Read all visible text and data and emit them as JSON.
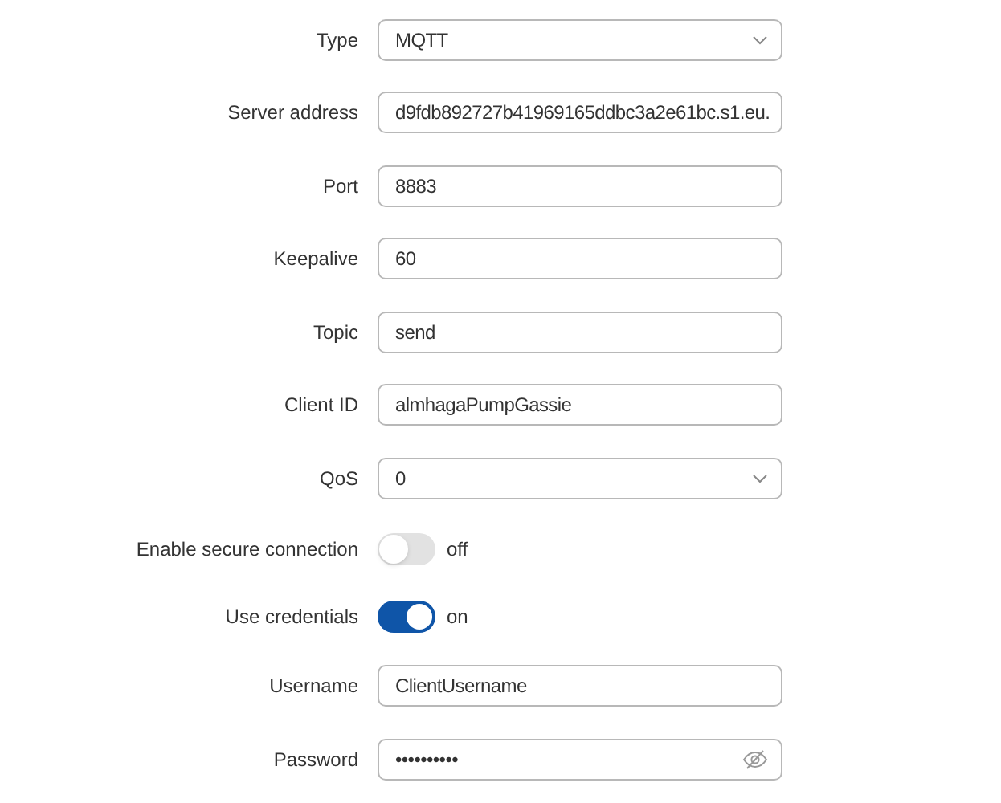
{
  "fields": [
    {
      "kind": "select",
      "label": "Type",
      "value": "MQTT"
    },
    {
      "kind": "text",
      "label": "Server address",
      "value": "d9fdb892727b41969165ddbc3a2e61bc.s1.eu."
    },
    {
      "kind": "text",
      "label": "Port",
      "value": "8883"
    },
    {
      "kind": "text",
      "label": "Keepalive",
      "value": "60"
    },
    {
      "kind": "text",
      "label": "Topic",
      "value": "send"
    },
    {
      "kind": "text",
      "label": "Client ID",
      "value": "almhagaPumpGassie"
    },
    {
      "kind": "select",
      "label": "QoS",
      "value": "0"
    },
    {
      "kind": "toggle",
      "label": "Enable secure connection",
      "on": false,
      "state_text": "off"
    },
    {
      "kind": "toggle",
      "label": "Use credentials",
      "on": true,
      "state_text": "on"
    },
    {
      "kind": "text",
      "label": "Username",
      "value": "ClientUsername"
    },
    {
      "kind": "password",
      "label": "Password",
      "value": "••••••••••"
    }
  ]
}
